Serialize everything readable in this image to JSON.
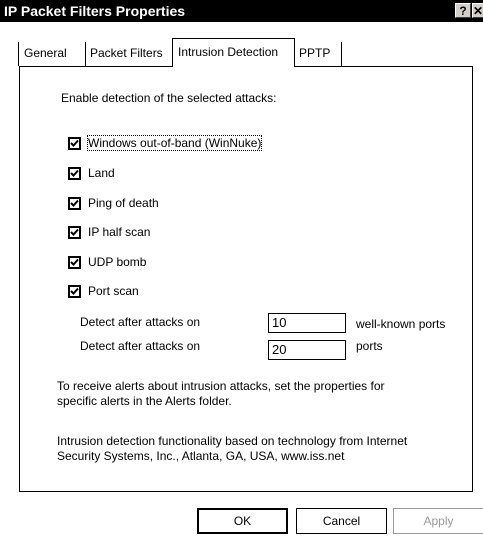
{
  "window": {
    "title": "IP Packet Filters Properties",
    "help_label": "?",
    "close_label": "✕"
  },
  "tabs": [
    {
      "label": "General",
      "active": false
    },
    {
      "label": "Packet Filters",
      "active": false
    },
    {
      "label": "Intrusion Detection",
      "active": true
    },
    {
      "label": "PPTP",
      "active": false
    }
  ],
  "panel": {
    "heading": "Enable detection of the selected attacks:",
    "attacks": [
      {
        "label": "Windows out-of-band (WinNuke)",
        "checked": true
      },
      {
        "label": "Land",
        "checked": true
      },
      {
        "label": "Ping of death",
        "checked": true
      },
      {
        "label": "IP half scan",
        "checked": true
      },
      {
        "label": "UDP bomb",
        "checked": true
      },
      {
        "label": "Port scan",
        "checked": true
      }
    ],
    "port_scan": {
      "wellknown_label": "Detect after attacks on",
      "wellknown_value": "10",
      "wellknown_suffix": "well-known ports",
      "ports_label": "Detect after attacks on",
      "ports_value": "20",
      "ports_suffix": "ports"
    },
    "alerts_note_line1": "To receive alerts about intrusion attacks, set the properties for",
    "alerts_note_line2": "specific alerts in the Alerts folder.",
    "credit_line1": "Intrusion detection functionality based on technology from Internet",
    "credit_line2": "Security Systems, Inc., Atlanta, GA, USA, www.iss.net"
  },
  "buttons": {
    "ok": "OK",
    "cancel": "Cancel",
    "apply": "Apply"
  }
}
